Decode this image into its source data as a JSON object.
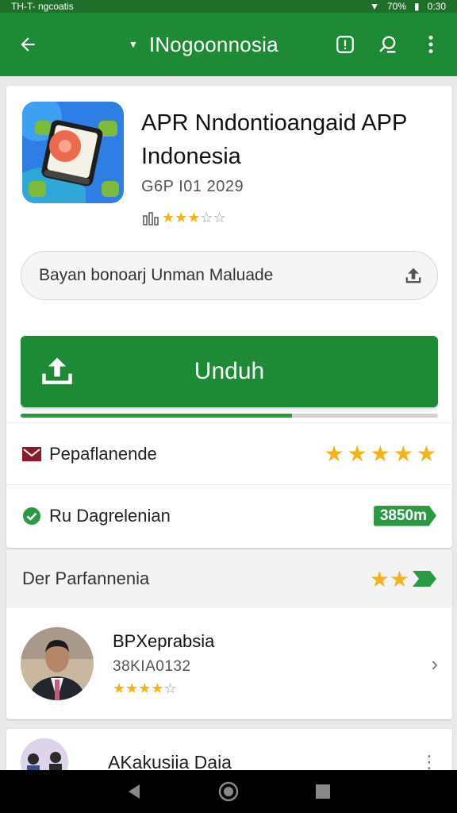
{
  "status_bar": {
    "left_text": "TH-T- ngcoatis",
    "battery": "70%",
    "time": "0:30"
  },
  "app_bar": {
    "title": "INogoonnosia"
  },
  "app": {
    "title": "APR Nndontioangaid APP Indonesia",
    "date": "G6P I01 2029",
    "rating_stars": 3,
    "rating_max": 5
  },
  "search": {
    "value": "Bayan bonoarj Unman Maluade"
  },
  "download": {
    "label": "Unduh",
    "progress": 0.65
  },
  "rows": [
    {
      "label": "Pepaflanende",
      "stars": 5
    },
    {
      "label": "Ru Dagrelenian",
      "value": "3850m"
    }
  ],
  "recommendation": {
    "header": "Der Parfannenia",
    "header_stars": 2,
    "item": {
      "name": "BPXeprabsia",
      "sub": "38KIA0132",
      "stars": 4,
      "stars_max": 5
    }
  },
  "next_item": {
    "name": "AKakusiia Daia"
  },
  "colors": {
    "brand_green": "#1f8a36",
    "star": "#f3b31b"
  }
}
